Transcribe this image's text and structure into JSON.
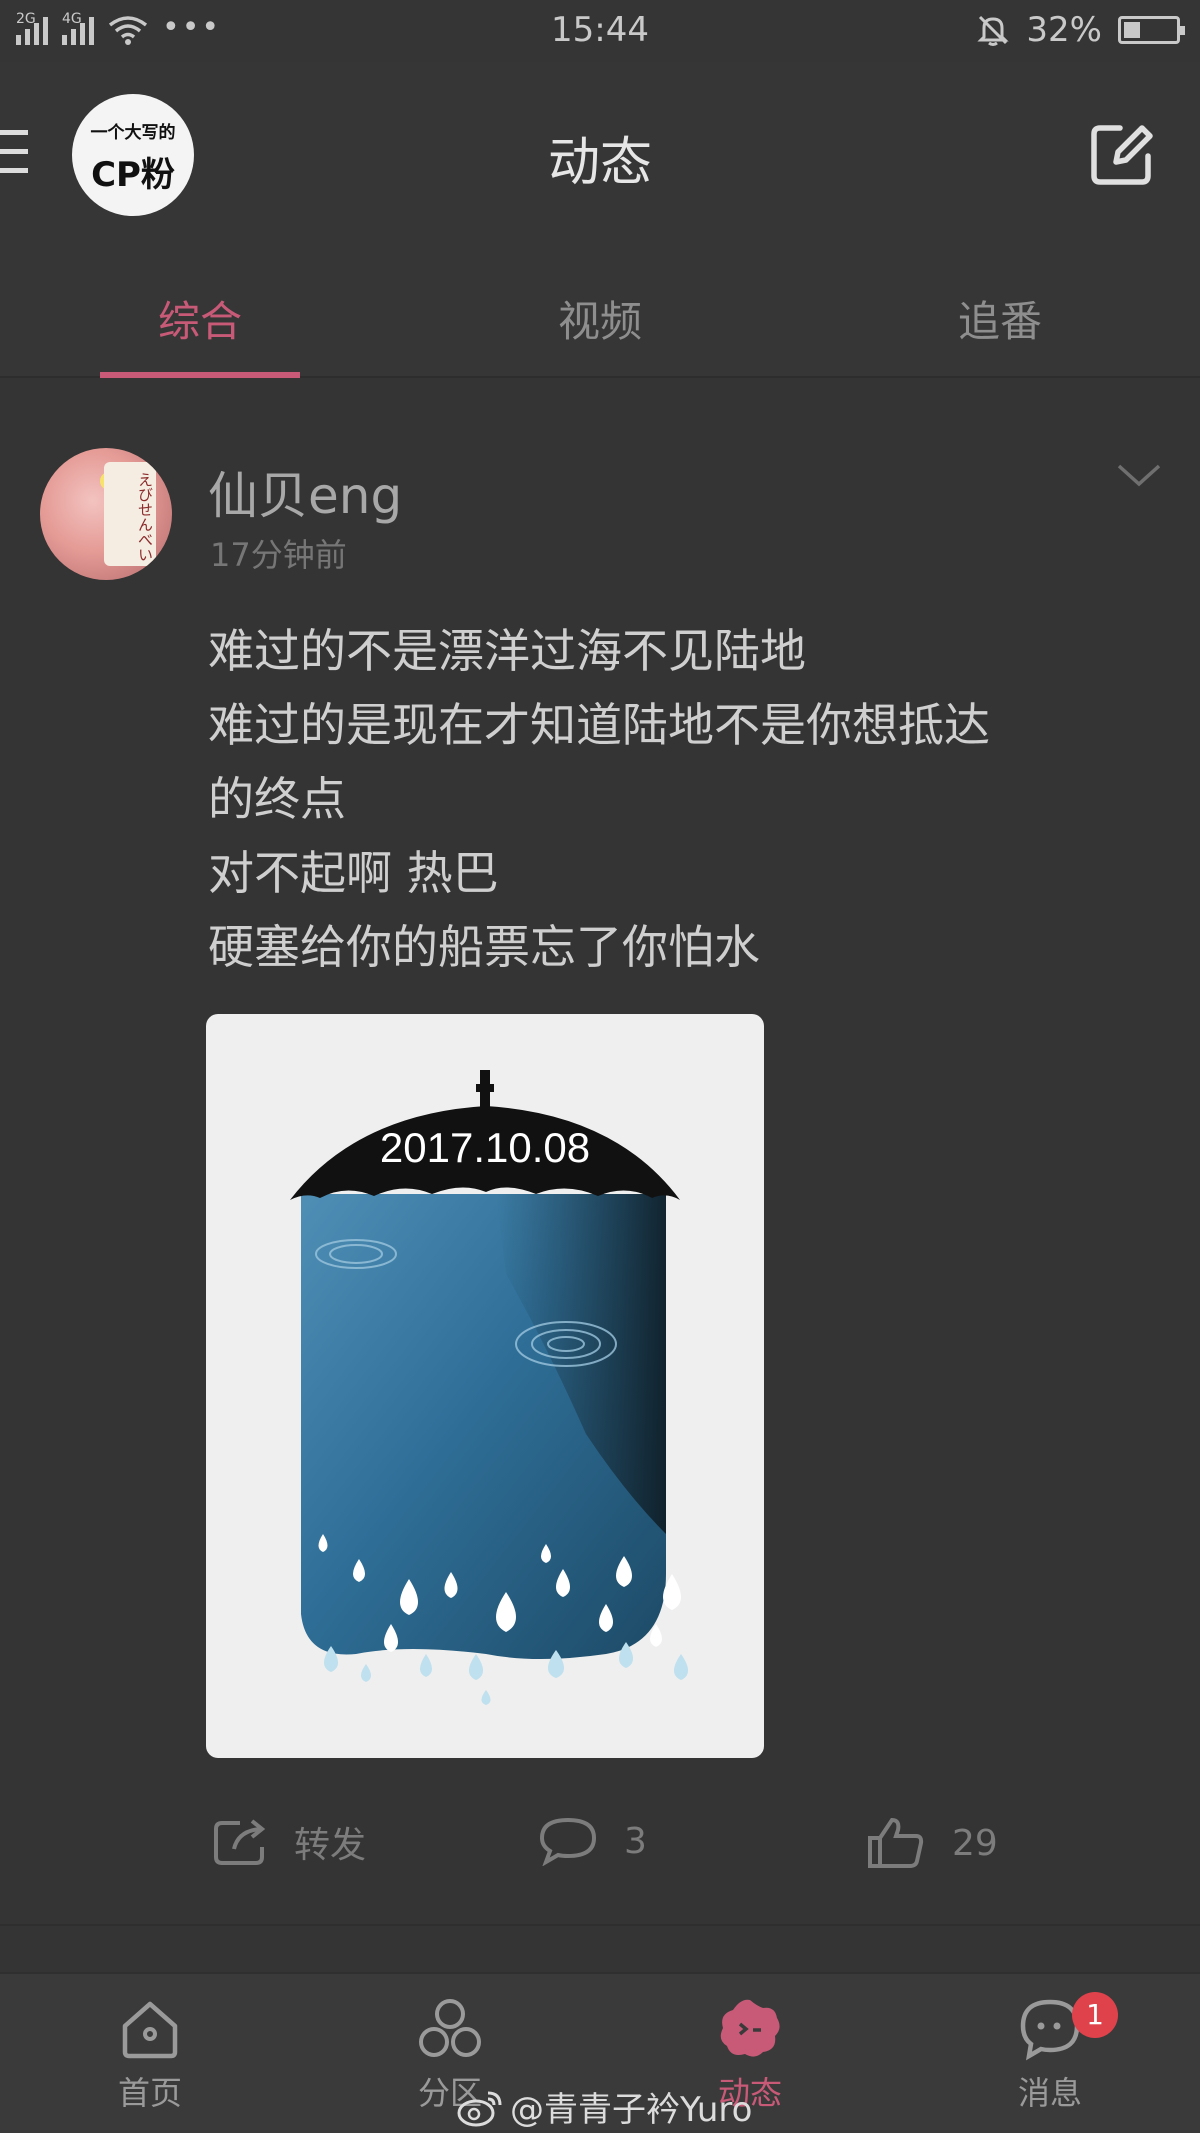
{
  "status_bar": {
    "network1": "2G",
    "network2": "4G",
    "time": "15:44",
    "battery_percent": "32%",
    "battery_level": 0.32
  },
  "header": {
    "logo_line1": "一个大写的",
    "logo_line2": "CP粉",
    "title": "动态"
  },
  "tabs": [
    {
      "label": "综合",
      "active": true
    },
    {
      "label": "视频",
      "active": false
    },
    {
      "label": "追番",
      "active": false
    }
  ],
  "post": {
    "avatar_text": "えびせんべい",
    "username": "仙贝eng",
    "time": "17分钟前",
    "text_lines": [
      "难过的不是漂洋过海不见陆地",
      "难过的是现在才知道陆地不是你想抵达",
      "的终点",
      "对不起啊 热巴",
      "硬塞给你的船票忘了你怕水"
    ],
    "image_date": "2017.10.08",
    "actions": {
      "repost_label": "转发",
      "comment_count": "3",
      "like_count": "29"
    }
  },
  "bottom_nav": [
    {
      "label": "首页",
      "icon": "home-icon",
      "active": false
    },
    {
      "label": "分区",
      "icon": "category-icon",
      "active": false
    },
    {
      "label": "动态",
      "icon": "dynamic-icon",
      "active": true
    },
    {
      "label": "消息",
      "icon": "message-icon",
      "active": false,
      "badge": "1"
    }
  ],
  "watermark": "@青青子衿Yuro",
  "colors": {
    "accent": "#c85a78",
    "background": "#343434",
    "badge": "#e0424c"
  }
}
